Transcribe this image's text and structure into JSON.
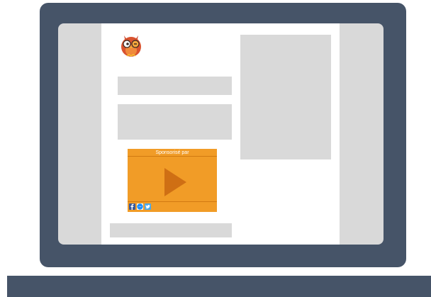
{
  "ad": {
    "sponsored_label": "Sponsorisé par"
  },
  "icons": {
    "logo": "owl-logo-icon",
    "play": "play-icon",
    "social": [
      "facebook-icon",
      "messenger-icon",
      "twitter-icon"
    ]
  },
  "colors": {
    "frame": "#465468",
    "placeholder": "#d9d9d9",
    "ad_background": "#f19c27",
    "play_button": "#cf6f14",
    "facebook": "#3b5998",
    "messenger": "#1a8cff",
    "twitter": "#4aa8e8"
  }
}
